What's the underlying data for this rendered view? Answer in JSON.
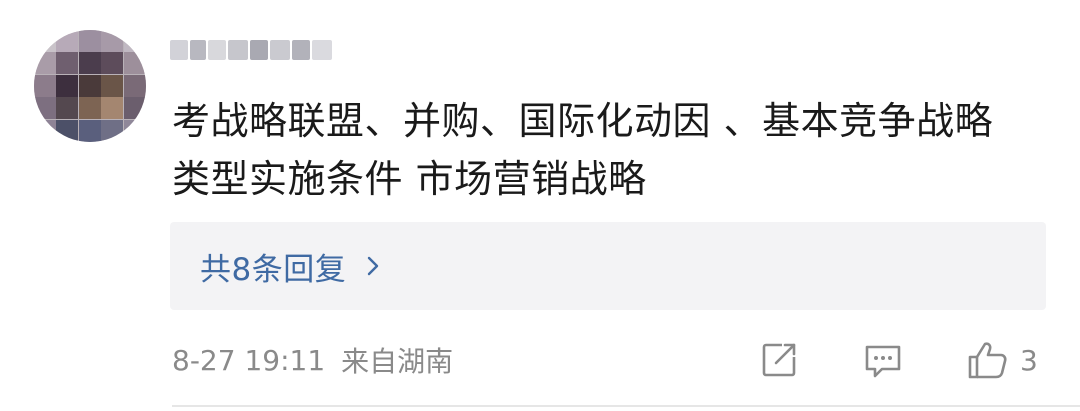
{
  "comment": {
    "text_lines": [
      "考战略联盟、并购、国际化动因 、基本竞争战略",
      "类型实施条件 市场营销战略"
    ],
    "replies_label": "共8条回复",
    "date": "8-27 19:11",
    "location": "来自湖南",
    "like_count": "3"
  },
  "icons": {
    "replies_chevron": "chevron-right-icon",
    "share": "share-icon",
    "reply": "comment-icon",
    "like": "thumbs-up-icon"
  },
  "colors": {
    "link_blue": "#3f6aa3",
    "meta_gray": "#8a8a8a",
    "reply_bg": "#f3f3f5",
    "text": "#1a1a1a"
  }
}
